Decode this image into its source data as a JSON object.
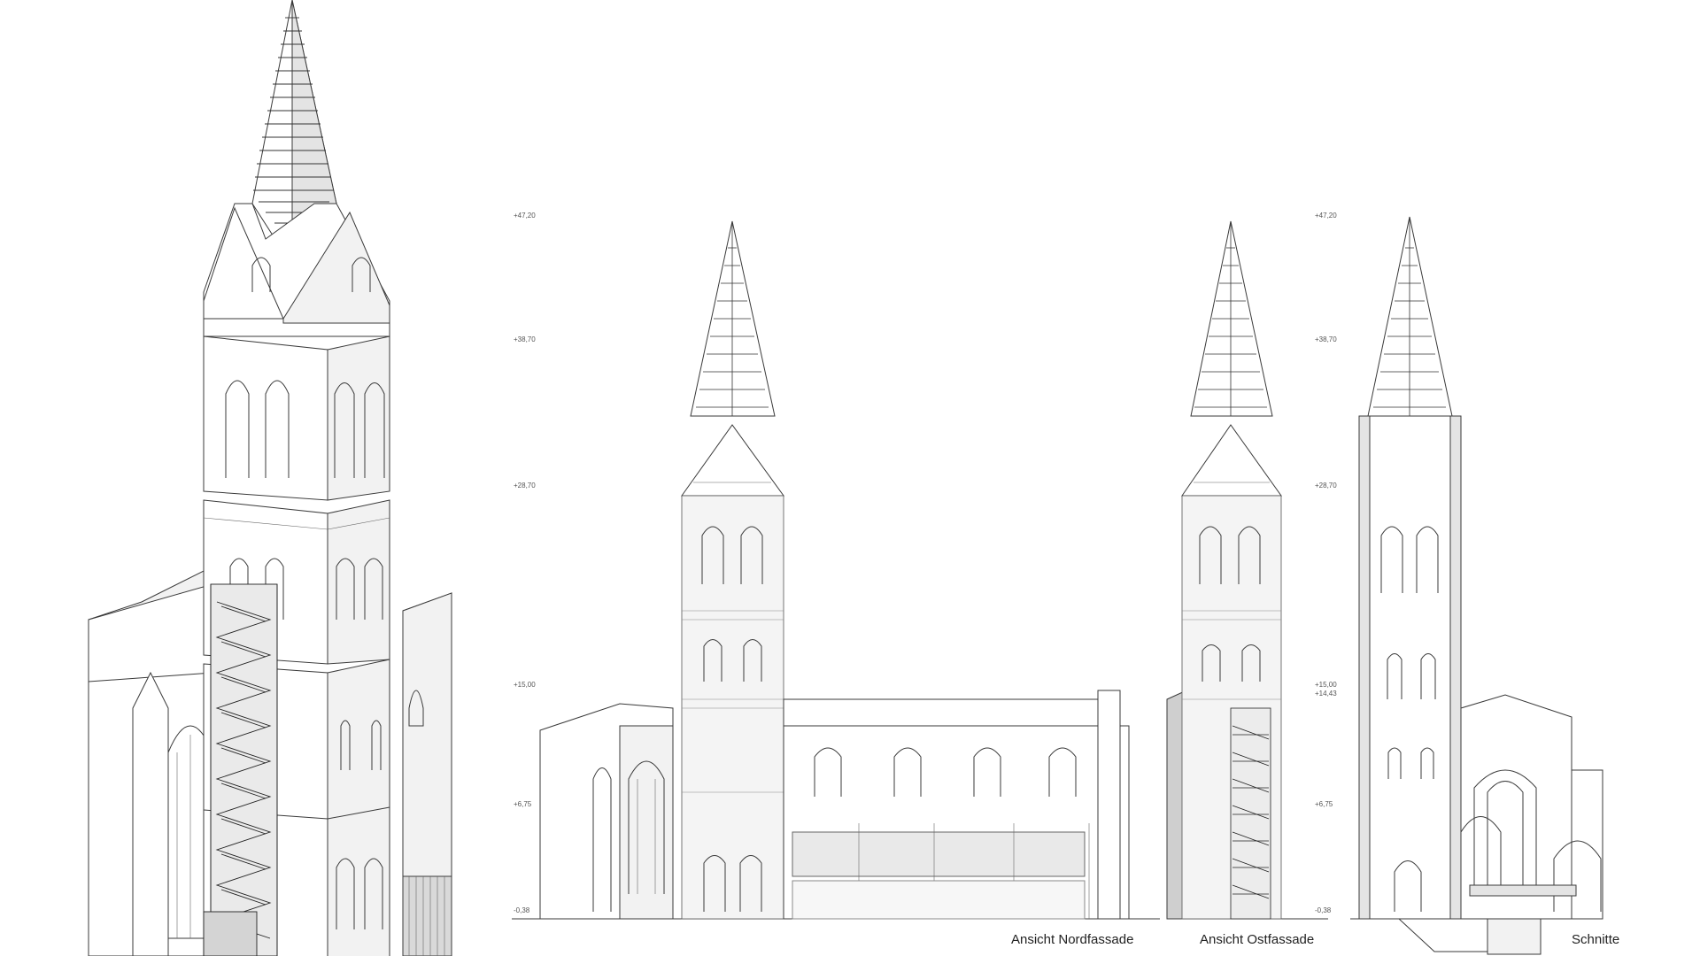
{
  "drawing_labels": {
    "north_facade": "Ansicht Nordfassade",
    "east_facade": "Ansicht Ostfassade",
    "sections": "Schnitte"
  },
  "elevation_marks": {
    "north": [
      "+47,20",
      "+38,70",
      "+28,70",
      "+15,00",
      "+6,75",
      "-0,38"
    ],
    "east": [
      "+47,20",
      "+38,70",
      "+28,70",
      "+15,00",
      "+14,43",
      "+6,75",
      "-0,38"
    ]
  }
}
